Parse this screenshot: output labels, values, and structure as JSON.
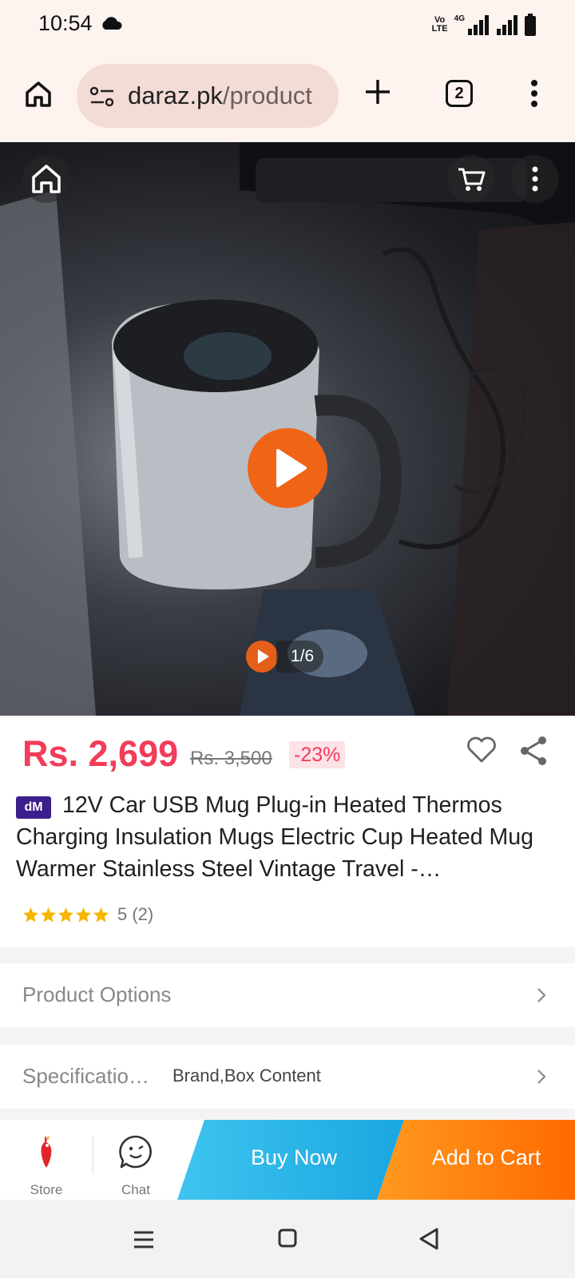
{
  "status_bar": {
    "time": "10:54",
    "network_label": "4G",
    "volte_line1": "Vo",
    "volte_line2": "LTE",
    "icons": [
      "cloud-icon",
      "signal-icon",
      "signal-icon",
      "battery-icon"
    ]
  },
  "browser": {
    "url_domain": "daraz.pk",
    "url_path": "/product",
    "tab_count": "2",
    "icons": [
      "home-icon",
      "site-settings-icon",
      "new-tab-icon",
      "menu-icon"
    ]
  },
  "media": {
    "counter": "1/6",
    "icons": [
      "home-icon",
      "cart-icon",
      "more-icon",
      "play-icon"
    ]
  },
  "product": {
    "price": "Rs. 2,699",
    "original_price": "Rs. 3,500",
    "discount": "-23%",
    "badge": "dM",
    "title": "12V Car USB Mug Plug-in Heated Thermos Charging Insulation Mugs Electric Cup Heated Mug Warmer Stainless Steel Vintage Travel -…",
    "rating_value": 5,
    "rating_text": "5 (2)",
    "star_color": "#f7b500"
  },
  "rows": {
    "options_label": "Product Options",
    "specs_label": "Specificatio…",
    "specs_value": "Brand,Box Content"
  },
  "action_bar": {
    "store_label": "Store",
    "chat_label": "Chat",
    "buy_now_label": "Buy Now",
    "add_to_cart_label": "Add to Cart"
  },
  "colors": {
    "price": "#f23c5a",
    "buy_now": "#1aa6e0",
    "add_to_cart": "#ff6a00",
    "play": "#f06418"
  }
}
